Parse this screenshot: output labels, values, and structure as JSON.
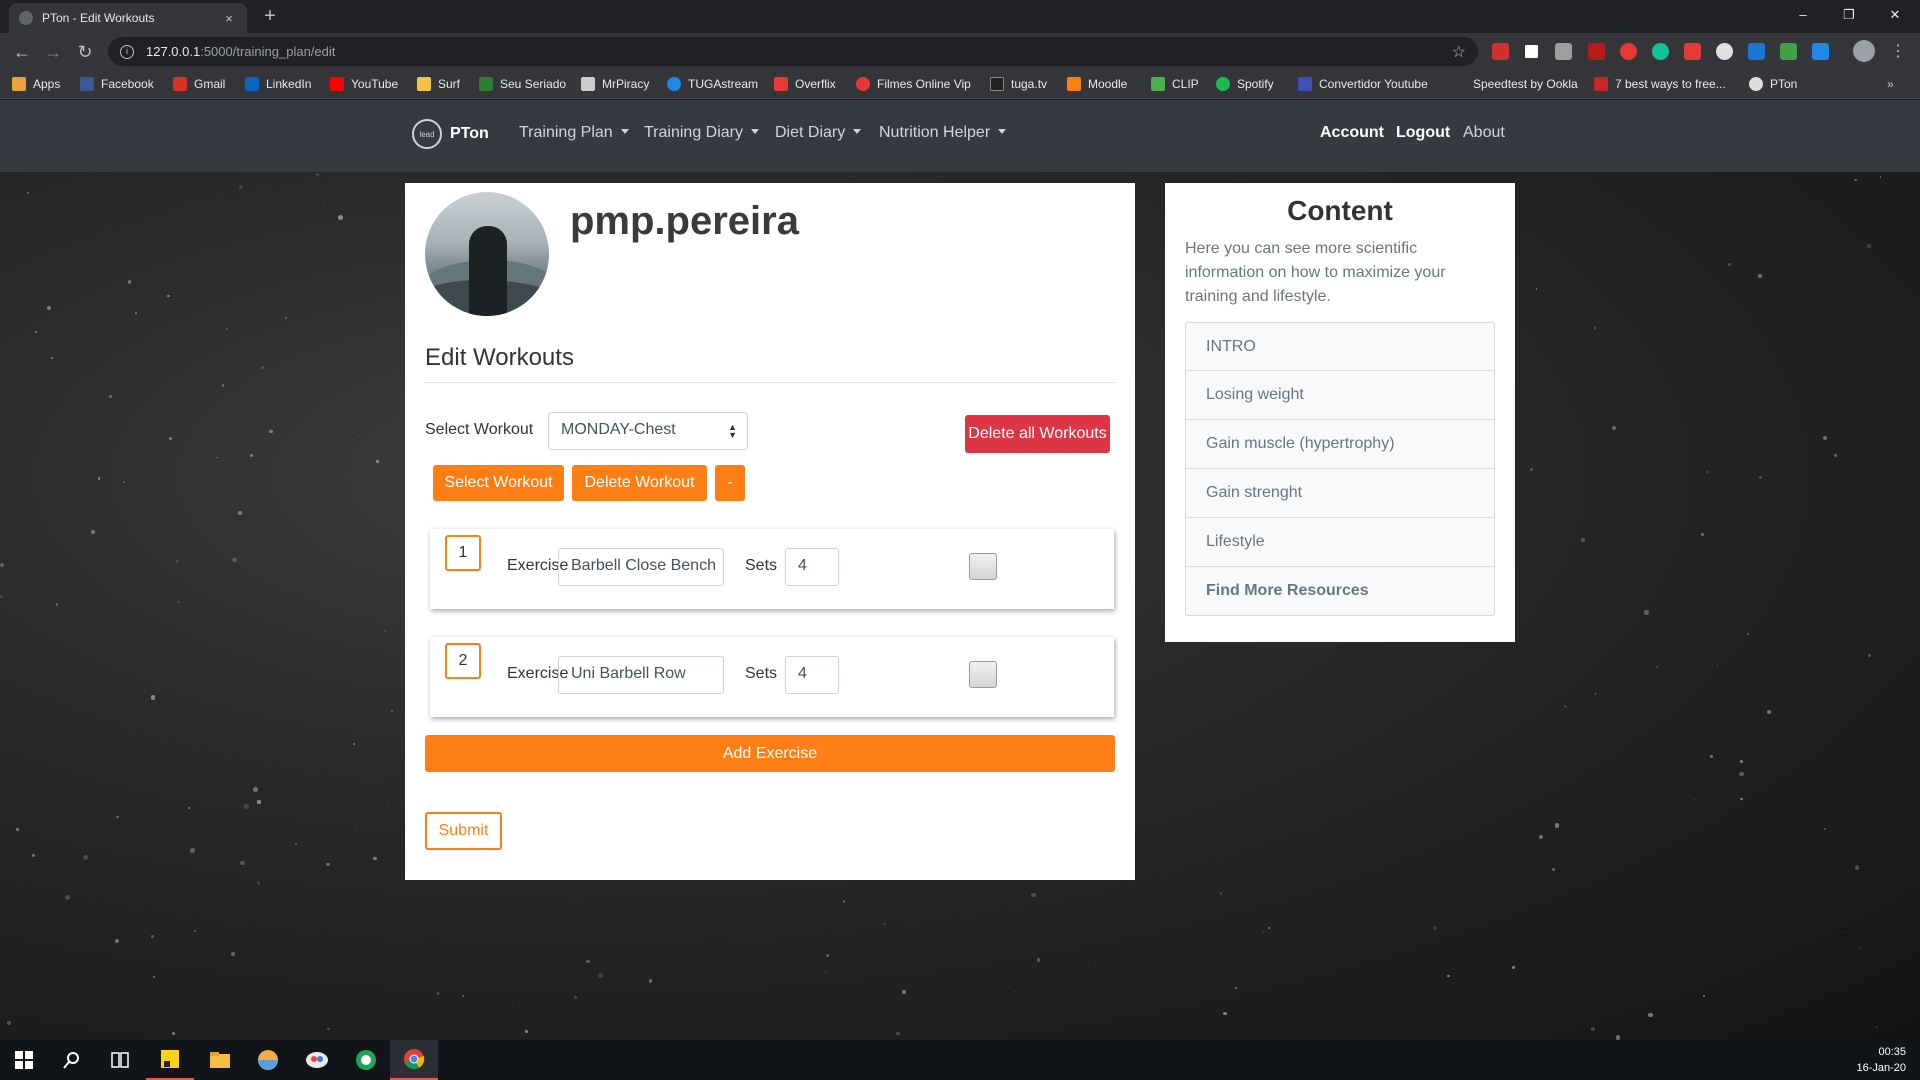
{
  "browser": {
    "tab_title": "PTon - Edit Workouts",
    "tab_close": "×",
    "new_tab": "+",
    "url_host": "127.0.0.1",
    "url_path": ":5000/training_plan/edit",
    "window_controls": {
      "minimize": "–",
      "restore": "❐",
      "close": "✕"
    }
  },
  "bookmarks": [
    {
      "label": "Apps",
      "icon": "apps-grid-icon",
      "color": "#e8a33d"
    },
    {
      "label": "Facebook",
      "icon": "facebook-icon",
      "color": "#3b5998"
    },
    {
      "label": "Gmail",
      "icon": "gmail-icon",
      "color": "#d93025"
    },
    {
      "label": "LinkedIn",
      "icon": "linkedin-icon",
      "color": "#0a66c2"
    },
    {
      "label": "YouTube",
      "icon": "youtube-icon",
      "color": "#ff0000"
    },
    {
      "label": "Surf",
      "icon": "folder-icon",
      "color": "#f4c542"
    },
    {
      "label": "Seu Seriado",
      "icon": "seriado-icon",
      "color": "#2e7d32"
    },
    {
      "label": "MrPiracy",
      "icon": "mrpiracy-icon",
      "color": "#cccccc"
    },
    {
      "label": "TUGAstream",
      "icon": "tugastream-icon",
      "color": "#1e88e5"
    },
    {
      "label": "Overflix",
      "icon": "overflix-icon",
      "color": "#e53935"
    },
    {
      "label": "Filmes Online Vip",
      "icon": "filmes-icon",
      "color": "#e53935"
    },
    {
      "label": "tuga.tv",
      "icon": "tugatv-icon",
      "color": "#222222"
    },
    {
      "label": "Moodle",
      "icon": "moodle-icon",
      "color": "#f98012"
    },
    {
      "label": "CLIP",
      "icon": "clip-icon",
      "color": "#4caf50"
    },
    {
      "label": "Spotify",
      "icon": "spotify-icon",
      "color": "#1db954"
    },
    {
      "label": "Convertidor Youtube",
      "icon": "convertidor-icon",
      "color": "#3f51b5"
    },
    {
      "label": "Speedtest by Ookla",
      "icon": "",
      "color": ""
    },
    {
      "label": "7 best ways to free...",
      "icon": "article-icon",
      "color": "#c62828"
    },
    {
      "label": "PTon",
      "icon": "globe-icon",
      "color": "#dddddd"
    }
  ],
  "navbar": {
    "brand": "PTon",
    "logo_text": "lead",
    "menus": [
      "Training Plan",
      "Training Diary",
      "Diet Diary",
      "Nutrition Helper"
    ],
    "account": "Account",
    "logout": "Logout",
    "about": "About"
  },
  "profile": {
    "username": "pmp.pereira"
  },
  "edit": {
    "title": "Edit Workouts",
    "select_label": "Select Workout",
    "selected_workout": "MONDAY-Chest",
    "delete_all": "Delete all Workouts",
    "select_button": "Select Workout",
    "delete_button": "Delete Workout",
    "minus_button": "-",
    "exercise_label": "Exercise",
    "sets_label": "Sets",
    "exercises": [
      {
        "number": "1",
        "name": "Barbell Close Bench",
        "sets": "4"
      },
      {
        "number": "2",
        "name": "Uni Barbell Row",
        "sets": "4"
      }
    ],
    "add_exercise": "Add Exercise",
    "submit": "Submit"
  },
  "content": {
    "title": "Content",
    "description": "Here you can see more scientific information on how to maximize your training and lifestyle.",
    "items": [
      "INTRO",
      "Losing weight",
      "Gain muscle (hypertrophy)",
      "Gain strenght",
      "Lifestyle",
      "Find More Resources"
    ]
  },
  "taskbar": {
    "time": "00:35",
    "date": "16-Jan-20"
  },
  "colors": {
    "accent": "#fd7e14",
    "danger": "#dc3545",
    "navbar": "#343a40"
  }
}
